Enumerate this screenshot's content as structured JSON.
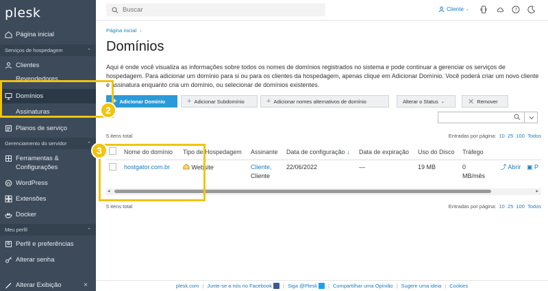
{
  "app": {
    "logo": "plesk"
  },
  "sidebar": {
    "items_top": [
      {
        "label": "Página inicial"
      }
    ],
    "sections": [
      {
        "label": "Serviços de hospedagem"
      },
      {
        "label": "Gerenciamento do servidor"
      },
      {
        "label": "Meu perfil"
      }
    ],
    "hosting_items": [
      {
        "label": "Clientes"
      },
      {
        "label": "Revendedores"
      },
      {
        "label": "Domínios"
      },
      {
        "label": "Assinaturas"
      },
      {
        "label": "Planos de serviço"
      }
    ],
    "server_items": [
      {
        "label": "Ferramentas &"
      },
      {
        "label": "Configurações"
      },
      {
        "label": "WordPress"
      },
      {
        "label": "Extensões"
      },
      {
        "label": "Docker"
      }
    ],
    "profile_items": [
      {
        "label": "Perfil e preferências"
      },
      {
        "label": "Alterar senha"
      }
    ],
    "bottom": {
      "label": "Alterar Exibição"
    }
  },
  "topbar": {
    "search_placeholder": "Buscar",
    "user_label": "Cliente"
  },
  "main": {
    "breadcrumb": "Página inicial",
    "title": "Domínios",
    "description": "Aqui é onde você visualiza as informações sobre todos os nomes de domínios registrados no sistema e pode continuar a gerenciar os serviços de hospedagem. Para adicionar um domínio para si ou para os clientes da hospedagem, apenas clique em Adicionar Domínio. Você poderá criar um novo cliente e assinatura enquanto cria um domínio, ou selecionar de domínios existentes.",
    "toolbar": {
      "add_domain": "Adicionar Domínio",
      "add_subdomain": "Adicionar Subdomínio",
      "add_alias": "Adicionar nomes alternativos de domínio",
      "change_status": "Alterar o Status",
      "remove": "Remover"
    },
    "items_total": "5 itens total",
    "per_page_label": "Entradas por página:",
    "per_page_options": [
      "10",
      "25",
      "100",
      "Todos"
    ],
    "table": {
      "columns": [
        "Nome do domínio",
        "Tipo de Hospedagem",
        "Assinante",
        "Data de configuração",
        "Data de expiração",
        "Uso do Disco",
        "Tráfego"
      ],
      "sort_indicator": "↓",
      "rows": [
        {
          "domain": "hostgator.com.br",
          "hosting": "Website",
          "subscriber_link": "Cliente,",
          "subscriber": "Cliente",
          "setup_date": "22/06/2022",
          "expiration": "—",
          "disk": "19 MB",
          "traffic_line1": "0",
          "traffic_line2": "MB/mês",
          "action_open": "Abrir",
          "action_preview": "P"
        }
      ]
    }
  },
  "footer": {
    "links": [
      "plesk.com",
      "Junte-se a nós no Facebook",
      "Siga @Plesk",
      "Compartilhar uma Opinião",
      "Sugerir uma ideia",
      "Cookies"
    ]
  },
  "callouts": [
    "2",
    "3"
  ],
  "colors": {
    "sidebar": "#3c4a5a",
    "accent": "#2a9ad8",
    "link": "#1a7cbf",
    "callout": "#f1c40f"
  }
}
